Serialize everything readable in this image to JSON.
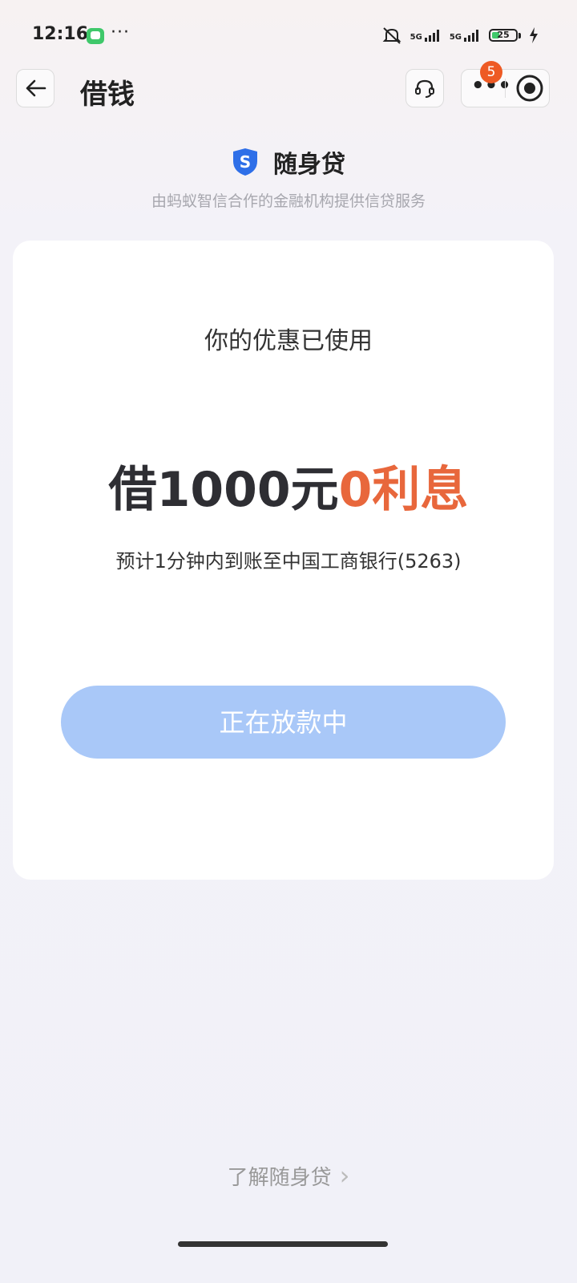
{
  "status_bar": {
    "time": "12:16",
    "dots": "···",
    "signal_1_label": "5G",
    "signal_2_label": "5G",
    "battery_level": "25"
  },
  "nav": {
    "title": "借钱",
    "more_glyph": "•••",
    "badge_count": "5"
  },
  "brand": {
    "icon_letter": "S",
    "name": "随身贷",
    "subtitle": "由蚂蚁智信合作的金融机构提供信贷服务"
  },
  "card": {
    "heading": "你的优惠已使用",
    "offer_main": "借1000元",
    "offer_accent": "0利息",
    "arrival_text": "预计1分钟内到账至中国工商银行(5263)",
    "button_label": "正在放款中"
  },
  "footer": {
    "learn_link": "了解随身贷",
    "chevron": "›"
  },
  "colors": {
    "accent_orange": "#e8673c",
    "button_blue_disabled": "#a9c8f8",
    "brand_blue": "#2e6fe8",
    "badge_red": "#ee5a24"
  },
  "icons": {
    "back": "arrow-left-icon",
    "support": "headset-icon",
    "more": "more-dots-icon",
    "record": "record-icon",
    "brand": "shield-s-icon",
    "chevron": "chevron-right-icon"
  }
}
